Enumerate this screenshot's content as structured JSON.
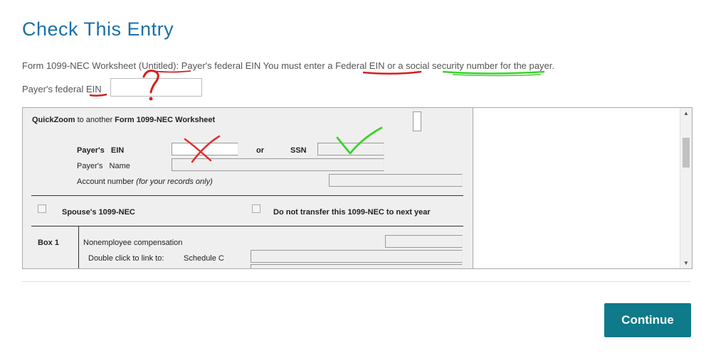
{
  "page": {
    "title": "Check This Entry",
    "message": {
      "part1": "Form 1099-NEC Worksheet (Untitled): Payer's federal EIN You must enter a ",
      "federal_ein": "Federal EIN",
      "part2": " or a ",
      "ssn": "social security number",
      "part3": " for the payer."
    },
    "ein_label_prefix": "Payer's federal ",
    "ein_label_ein": "EIN",
    "ein_value": ""
  },
  "worksheet": {
    "quickzoom_prefix": "QuickZoom",
    "quickzoom_middle": " to another ",
    "quickzoom_form": "Form 1099-NEC Worksheet",
    "payer_ein_label": "Payer's",
    "ein_label": "EIN",
    "or_label": "or",
    "ssn_label": "SSN",
    "payer_name_label1": "Payer's",
    "payer_name_label2": "Name",
    "account_number_label": "Account number",
    "account_number_note": "(for your records only)",
    "spouse_label": "Spouse's 1099-NEC",
    "no_transfer_label": "Do not transfer this 1099-NEC to next year",
    "box1_label": "Box 1",
    "nonemployee_label": "Nonemployee compensation",
    "double_click_label": "Double click to link to:",
    "schedule_c_label": "Schedule C"
  },
  "annotations": {
    "question_color": "#d42020",
    "x_color": "#e03030",
    "underline_red": "#d42020",
    "check_color": "#3cd22b"
  },
  "actions": {
    "continue_label": "Continue"
  },
  "colors": {
    "title": "#1c6fa8",
    "continue_bg": "#0e7a8a"
  }
}
